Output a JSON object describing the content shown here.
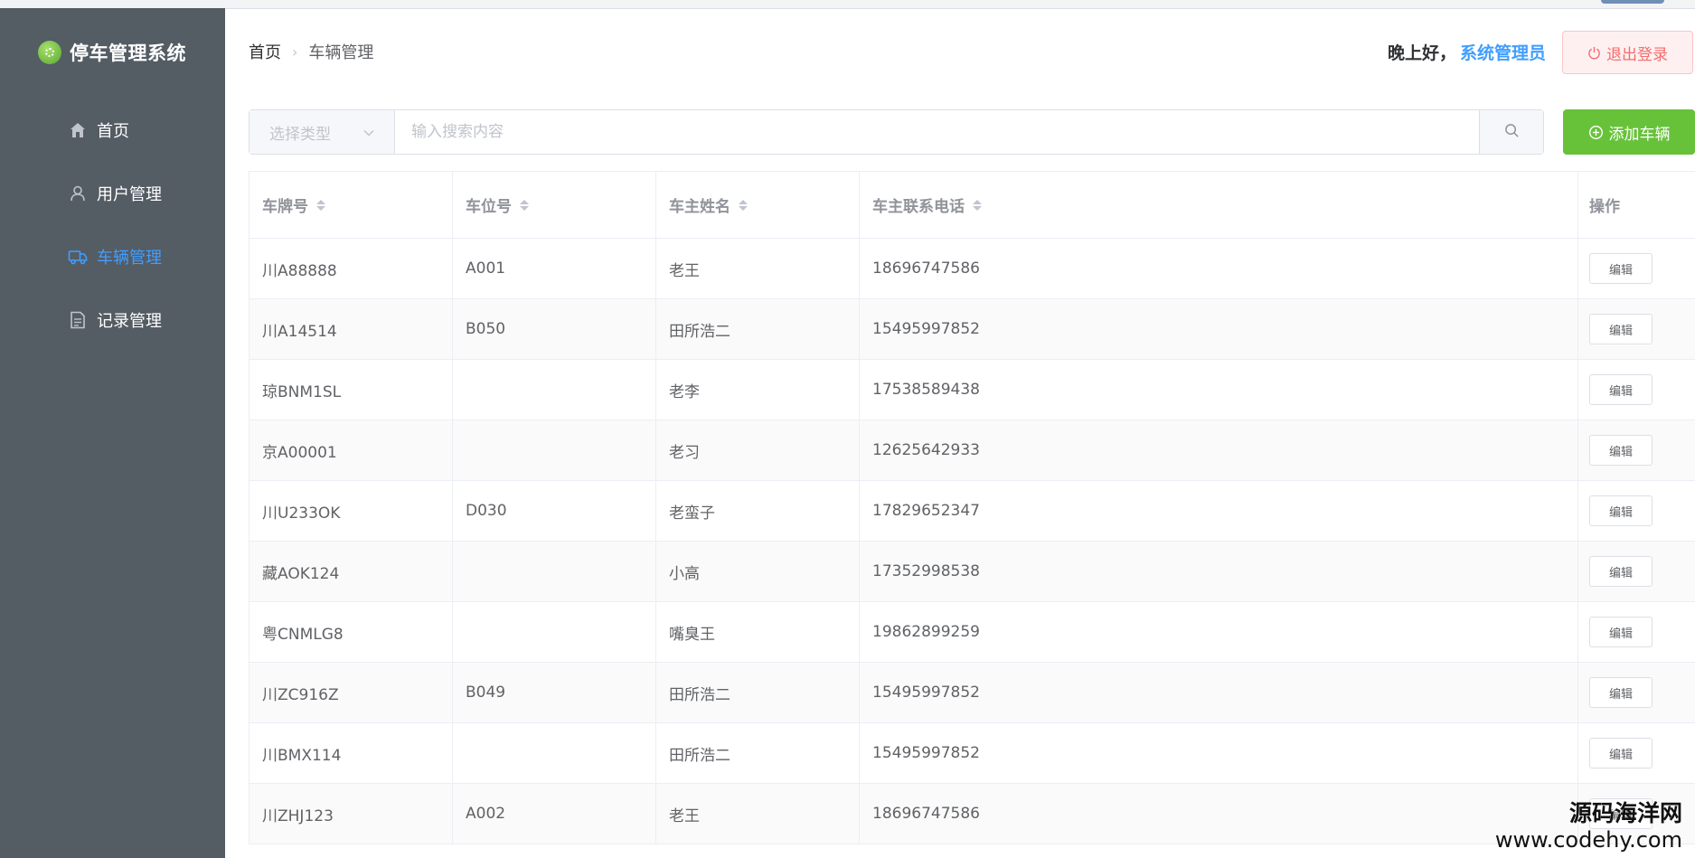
{
  "app": {
    "title": "停车管理系统"
  },
  "sidebar": {
    "items": [
      {
        "label": "首页",
        "icon": "home-icon",
        "active": false
      },
      {
        "label": "用户管理",
        "icon": "user-icon",
        "active": false
      },
      {
        "label": "车辆管理",
        "icon": "truck-icon",
        "active": true
      },
      {
        "label": "记录管理",
        "icon": "document-icon",
        "active": false
      }
    ]
  },
  "header": {
    "breadcrumb": {
      "home": "首页",
      "current": "车辆管理"
    },
    "greeting": "晚上好，",
    "user": "系统管理员",
    "logout_label": "退出登录"
  },
  "search": {
    "type_placeholder": "选择类型",
    "input_placeholder": "输入搜索内容",
    "add_label": "添加车辆"
  },
  "table": {
    "columns": [
      "车牌号",
      "车位号",
      "车主姓名",
      "车主联系电话",
      "操作"
    ],
    "edit_label": "编辑",
    "rows": [
      {
        "plate": "川A88888",
        "spot": "A001",
        "owner": "老王",
        "phone": "18696747586"
      },
      {
        "plate": "川A14514",
        "spot": "B050",
        "owner": "田所浩二",
        "phone": "15495997852"
      },
      {
        "plate": "琼BNM1SL",
        "spot": "",
        "owner": "老李",
        "phone": "17538589438"
      },
      {
        "plate": "京A00001",
        "spot": "",
        "owner": "老习",
        "phone": "12625642933"
      },
      {
        "plate": "川U233OK",
        "spot": "D030",
        "owner": "老蛮子",
        "phone": "17829652347"
      },
      {
        "plate": "藏AOK124",
        "spot": "",
        "owner": "小高",
        "phone": "17352998538"
      },
      {
        "plate": "粤CNMLG8",
        "spot": "",
        "owner": "嘴臭王",
        "phone": "19862899259"
      },
      {
        "plate": "川ZC916Z",
        "spot": "B049",
        "owner": "田所浩二",
        "phone": "15495997852"
      },
      {
        "plate": "川BMX114",
        "spot": "",
        "owner": "田所浩二",
        "phone": "15495997852"
      },
      {
        "plate": "川ZHJ123",
        "spot": "A002",
        "owner": "老王",
        "phone": "18696747586"
      }
    ]
  },
  "watermark": {
    "line1": "源码海洋网",
    "line2": "www.codehy.com"
  },
  "colors": {
    "sidebar_bg": "#545c64",
    "active": "#409eff",
    "success": "#67c23a",
    "danger": "#f56c6c"
  }
}
